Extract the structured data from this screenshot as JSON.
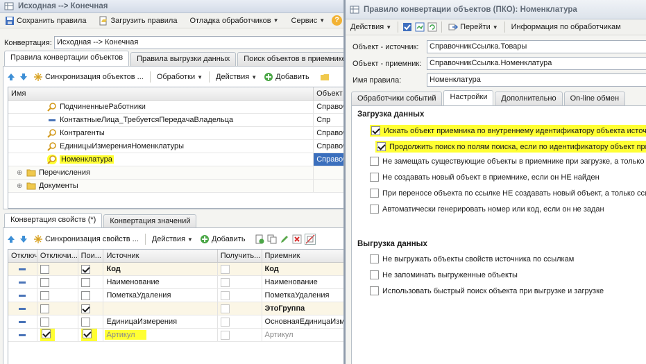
{
  "main": {
    "title": "Исходная --> Конечная",
    "toolbar": {
      "save": "Сохранить правила",
      "load": "Загрузить правила",
      "debug": "Отладка обработчиков",
      "service": "Сервис",
      "help": "?"
    },
    "conversion_label": "Конвертация:",
    "conversion_value": "Исходная --> Конечная",
    "tabs": [
      "Правила конвертации объектов",
      "Правила выгрузки данных",
      "Поиск объектов в приемнике"
    ],
    "rules_toolbar": {
      "sync": "Синхронизация объектов ...",
      "handlers": "Обработки",
      "actions": "Действия",
      "add": "Добавить"
    },
    "rules_grid": {
      "headers": [
        "Имя",
        "Объект"
      ],
      "rows": [
        {
          "name": "ПодчиненныеРаботники",
          "obj": "Справоч",
          "icon": "magnifier-icon"
        },
        {
          "name": "КонтактныеЛица_ТребуетсяПередачаВладельца",
          "obj": "Спр",
          "icon": "dash-icon"
        },
        {
          "name": "Контрагенты",
          "obj": "Справоч",
          "icon": "magnifier-icon"
        },
        {
          "name": "ЕдиницыИзмеренияНоменклатуры",
          "obj": "Справоч",
          "icon": "magnifier-icon"
        },
        {
          "name": "Номенклатура",
          "obj": "Справоч",
          "icon": "magnifier-icon"
        },
        {
          "name": "Перечисления",
          "obj": "",
          "icon": "folder-icon"
        },
        {
          "name": "Документы",
          "obj": "",
          "icon": "folder-icon"
        }
      ]
    },
    "lower_tabs": [
      "Конвертация свойств (*)",
      "Конвертация значений"
    ],
    "props_toolbar": {
      "sync": "Синхронизация свойств ...",
      "actions": "Действия",
      "add": "Добавить"
    },
    "props_grid": {
      "headers": [
        "Отключи...",
        "Пои...",
        "Источник",
        "Получить...",
        "Приемник"
      ],
      "rows": [
        {
          "off": false,
          "search": true,
          "src": "Код",
          "get": false,
          "dst": "Код",
          "bold": true
        },
        {
          "off": false,
          "search": false,
          "src": "Наименование",
          "get": false,
          "dst": "Наименование"
        },
        {
          "off": false,
          "search": false,
          "src": "ПометкаУдаления",
          "get": false,
          "dst": "ПометкаУдаления"
        },
        {
          "off": false,
          "search": true,
          "src": "",
          "get": false,
          "dst": "ЭтоГруппа",
          "bold": true
        },
        {
          "off": false,
          "search": false,
          "src": "ЕдиницаИзмерения",
          "get": false,
          "dst": "ОсновнаяЕдиницаИзм"
        },
        {
          "off": true,
          "search": true,
          "src": "Артикул",
          "get": false,
          "dst": "Артикул",
          "grey": true
        }
      ]
    }
  },
  "dialog": {
    "title": "Правило конвертации объектов (ПКО): Номенклатура",
    "toolbar": {
      "actions": "Действия",
      "goto": "Перейти",
      "info": "Информация по обработчикам"
    },
    "source_label": "Объект - источник:",
    "source_value": "СправочникСсылка.Товары",
    "dest_label": "Объект - приемник:",
    "dest_value": "СправочникСсылка.Номенклатура",
    "rule_label": "Имя правила:",
    "rule_value": "Номенклатура",
    "tabs": [
      "Обработчики событий",
      "Настройки",
      "Дополнительно",
      "On-line обмен"
    ],
    "load_section": "Загрузка данных",
    "load_options": [
      {
        "text": "Искать объект приемника по внутреннему идентификатору объекта источника",
        "checked": true
      },
      {
        "text": "Продолжить поиск по полям поиска, если по идентификатору объект приемника не найден",
        "checked": true
      },
      {
        "text": "Не замещать существующие объекты в приемнике при загрузке, а только создавать новые",
        "checked": false
      },
      {
        "text": "Не создавать новый объект в приемнике, если он НЕ найден",
        "checked": false
      },
      {
        "text": "При переносе объекта по ссылке НЕ создавать новый объект, а только ссылку",
        "checked": false
      },
      {
        "text": "Автоматически генерировать номер или код, если он не задан",
        "checked": false
      }
    ],
    "unload_section": "Выгрузка данных",
    "unload_options": [
      {
        "text": "Не выгружать объекты свойств источника по ссылкам",
        "checked": false
      },
      {
        "text": "Не запоминать выгруженные объекты",
        "checked": false
      },
      {
        "text": "Использовать быстрый поиск объекта при выгрузке и загрузке",
        "checked": false
      }
    ]
  },
  "colors": {
    "highlight": "#ffff33",
    "selection": "#3b6fbd",
    "accent": "#2f64b4"
  }
}
